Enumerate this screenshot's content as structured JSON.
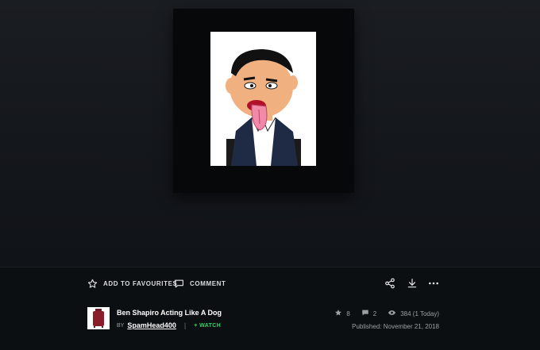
{
  "artwork": {
    "title": "Ben Shapiro Acting Like A Dog"
  },
  "actions": {
    "favourite_label": "ADD TO FAVOURITES",
    "comment_label": "COMMENT"
  },
  "toolbar_icons": [
    "share-icon",
    "download-icon",
    "more-icon"
  ],
  "meta": {
    "by_label": "BY",
    "author": "SpamHead400",
    "separator": "|",
    "watch_label": "+ WATCH",
    "favourites_count": "8",
    "comments_count": "2",
    "views": "384 (1 Today)",
    "published": "Published: November 21, 2018"
  },
  "colors": {
    "background": "#0f1217",
    "watch": "#2fd36b"
  }
}
